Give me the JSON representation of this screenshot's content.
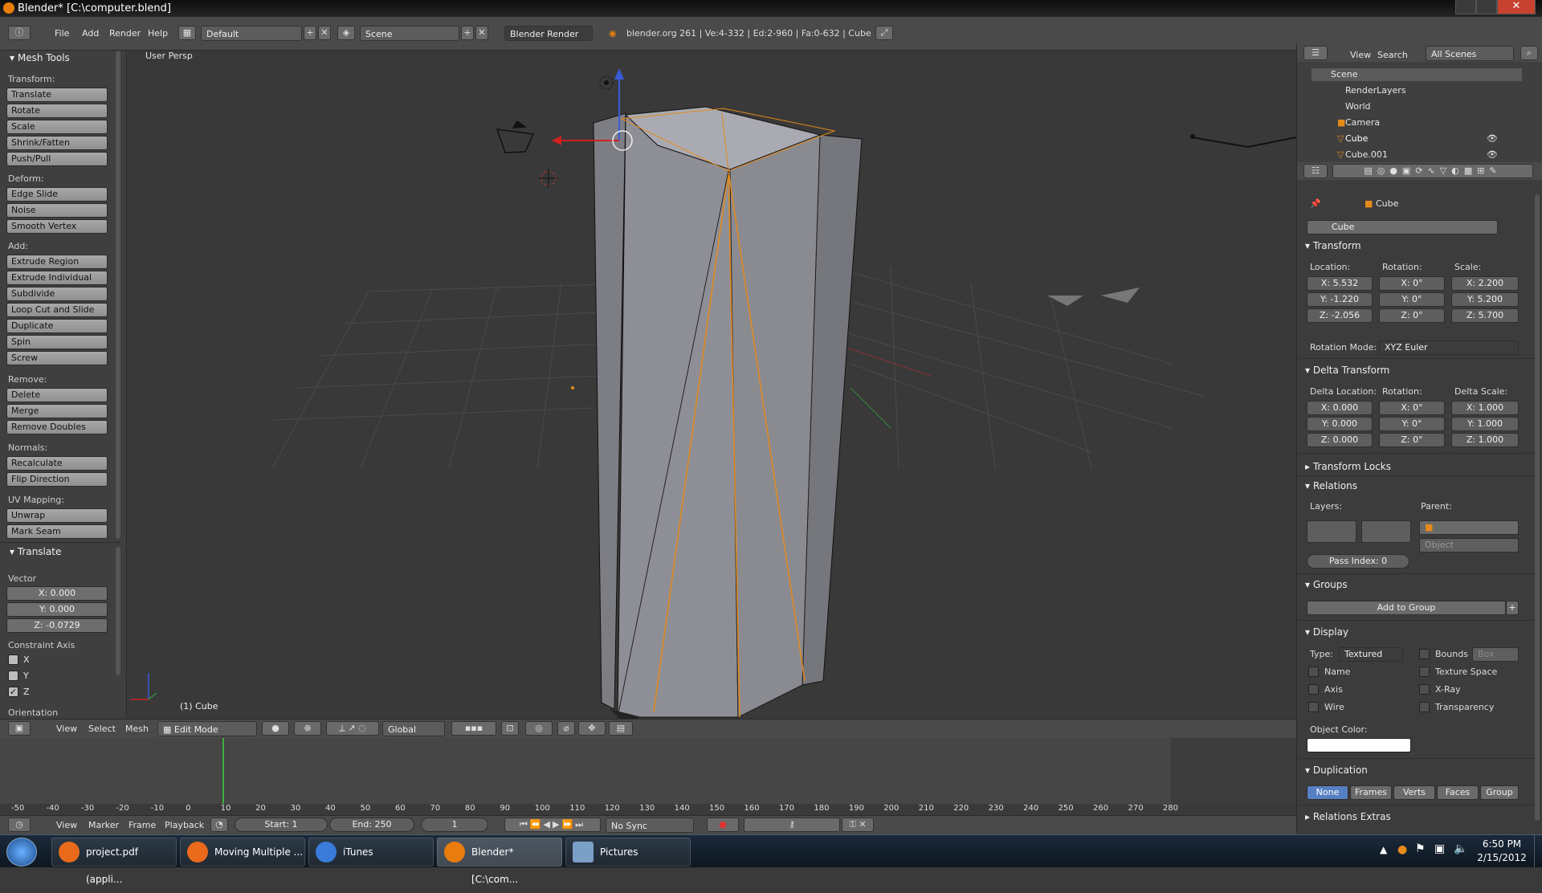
{
  "window": {
    "title": "Blender* [C:\\computer.blend]"
  },
  "topbar": {
    "menus": [
      "File",
      "Add",
      "Render",
      "Help"
    ],
    "layout": "Default",
    "scene": "Scene",
    "engine": "Blender Render",
    "stats": "blender.org 261 | Ve:4-332 | Ed:2-960 | Fa:0-632 | Cube"
  },
  "toolshelf": {
    "title": "Mesh Tools",
    "transform_label": "Transform:",
    "transform": [
      "Translate",
      "Rotate",
      "Scale",
      "Shrink/Fatten",
      "Push/Pull"
    ],
    "deform_label": "Deform:",
    "deform": [
      "Edge Slide",
      "Noise",
      "Smooth Vertex"
    ],
    "add_label": "Add:",
    "add": [
      "Extrude Region",
      "Extrude Individual",
      "Subdivide",
      "Loop Cut and Slide",
      "Duplicate",
      "Spin",
      "Screw"
    ],
    "remove_label": "Remove:",
    "remove": [
      "Delete",
      "Merge",
      "Remove Doubles"
    ],
    "normals_label": "Normals:",
    "normals": [
      "Recalculate",
      "Flip Direction"
    ],
    "uv_label": "UV Mapping:",
    "uv": [
      "Unwrap",
      "Mark Seam"
    ]
  },
  "operator": {
    "title": "Translate",
    "vector_label": "Vector",
    "x": "X: 0.000",
    "y": "Y: 0.000",
    "z": "Z: -0.0729",
    "constraint_label": "Constraint Axis",
    "cx": "X",
    "cy": "Y",
    "cz": "Z",
    "orientation_label": "Orientation"
  },
  "viewport": {
    "view_name": "User Persp",
    "object_label": "(1) Cube"
  },
  "vpheader": {
    "menus": [
      "View",
      "Select",
      "Mesh"
    ],
    "mode": "Edit Mode",
    "orientation": "Global"
  },
  "timeline": {
    "ruler": [
      "-50",
      "-40",
      "-30",
      "-20",
      "-10",
      "0",
      "10",
      "20",
      "30",
      "40",
      "50",
      "60",
      "70",
      "80",
      "90",
      "100",
      "110",
      "120",
      "130",
      "140",
      "150",
      "160",
      "170",
      "180",
      "190",
      "200",
      "210",
      "220",
      "230",
      "240",
      "250",
      "260",
      "270",
      "280"
    ],
    "menus": [
      "View",
      "Marker",
      "Frame",
      "Playback"
    ],
    "start": "Start: 1",
    "end": "End: 250",
    "current": "1",
    "sync": "No Sync"
  },
  "outliner": {
    "menus": [
      "View",
      "Search"
    ],
    "filter": "All Scenes",
    "items": [
      "Scene",
      "RenderLayers",
      "World",
      "Camera",
      "Cube",
      "Cube.001"
    ]
  },
  "props": {
    "breadcrumb": "Cube",
    "name": "Cube",
    "transform": {
      "title": "Transform",
      "location_label": "Location:",
      "rotation_label": "Rotation:",
      "scale_label": "Scale:",
      "loc": [
        "X: 5.532",
        "Y: -1.220",
        "Z: -2.056"
      ],
      "rot": [
        "X: 0°",
        "Y: 0°",
        "Z: 0°"
      ],
      "scale": [
        "X: 2.200",
        "Y: 5.200",
        "Z: 5.700"
      ],
      "mode_label": "Rotation Mode:",
      "mode": "XYZ Euler"
    },
    "delta": {
      "title": "Delta Transform",
      "location_label": "Delta Location:",
      "rotation_label": "Rotation:",
      "scale_label": "Delta Scale:",
      "loc": [
        "X: 0.000",
        "Y: 0.000",
        "Z: 0.000"
      ],
      "rot": [
        "X: 0°",
        "Y: 0°",
        "Z: 0°"
      ],
      "scale": [
        "X: 1.000",
        "Y: 1.000",
        "Z: 1.000"
      ]
    },
    "locks_title": "Transform Locks",
    "relations": {
      "title": "Relations",
      "layers_label": "Layers:",
      "parent_label": "Parent:",
      "parent_type": "Object",
      "pass_index": "Pass Index: 0"
    },
    "groups": {
      "title": "Groups",
      "add": "Add to Group"
    },
    "display": {
      "title": "Display",
      "type_label": "Type:",
      "type": "Textured",
      "bounds": "Bounds",
      "bounds_type": "Box",
      "name": "Name",
      "axis": "Axis",
      "wire": "Wire",
      "texture_space": "Texture Space",
      "xray": "X-Ray",
      "transparency": "Transparency",
      "color_label": "Object Color:"
    },
    "duplication": {
      "title": "Duplication",
      "options": [
        "None",
        "Frames",
        "Verts",
        "Faces",
        "Group"
      ]
    },
    "relations_extras": "Relations Extras"
  },
  "taskbar": {
    "tasks": [
      "project.pdf (appli...",
      "Moving Multiple ...",
      "iTunes",
      "Blender* [C:\\com...",
      "Pictures"
    ],
    "time": "6:50 PM",
    "date": "2/15/2012"
  }
}
